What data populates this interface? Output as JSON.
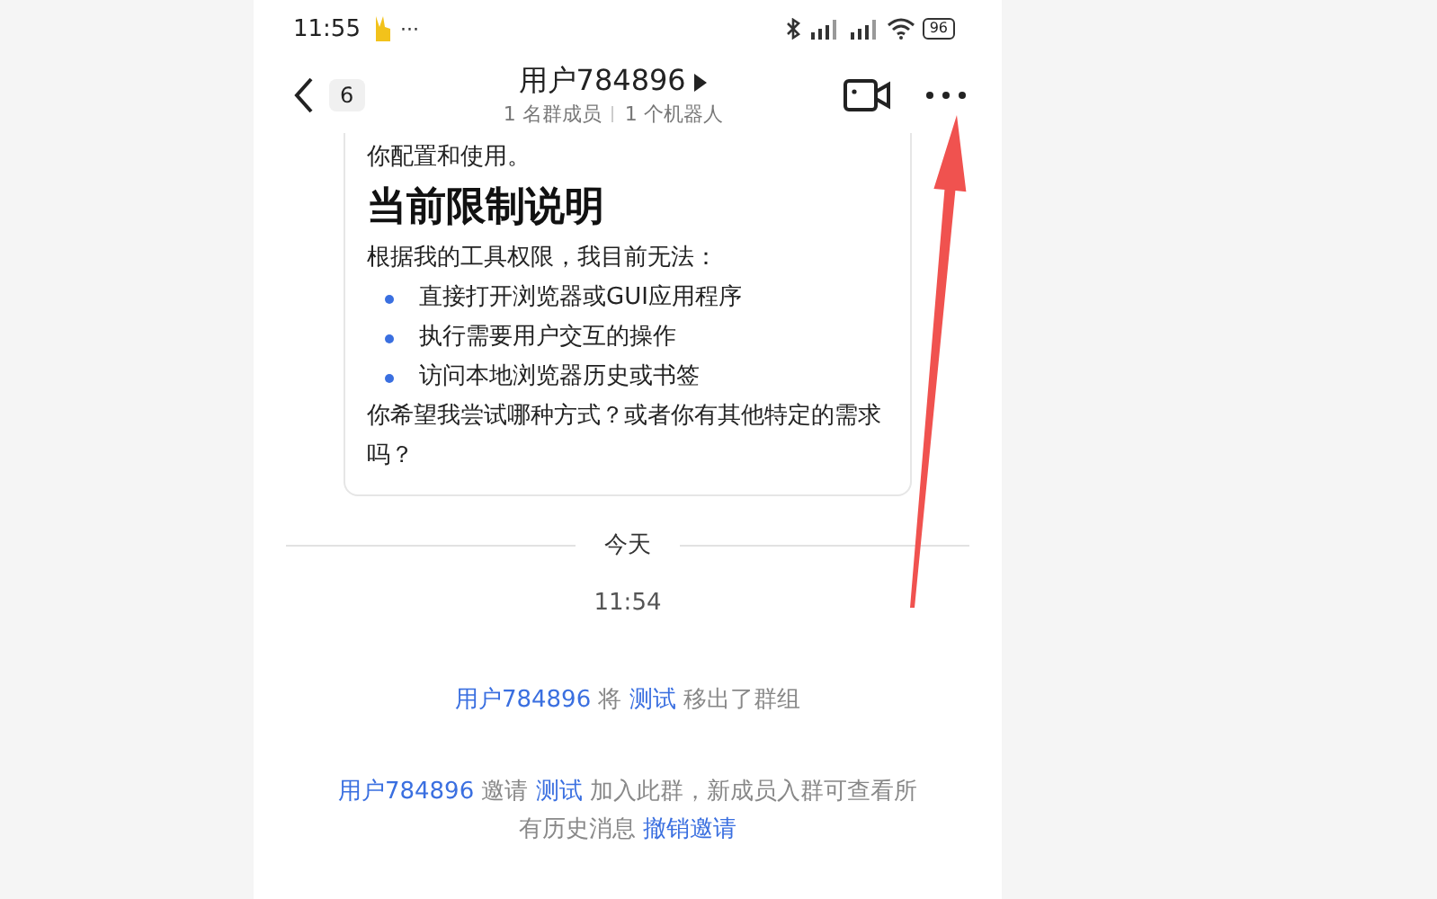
{
  "status_bar": {
    "time": "11:55",
    "dots": "···",
    "battery": "96"
  },
  "header": {
    "back_count": "6",
    "title": "用户784896",
    "subtitle_members": "1 名群成员",
    "subtitle_bots": "1 个机器人"
  },
  "card": {
    "intro": "你配置和使用。",
    "heading": "当前限制说明",
    "lead": "根据我的工具权限，我目前无法：",
    "bullets": [
      "直接打开浏览器或GUI应用程序",
      "执行需要用户交互的操作",
      "访问本地浏览器历史或书签"
    ],
    "closing": "你希望我尝试哪种方式？或者你有其他特定的需求吗？"
  },
  "divider": {
    "label": "今天"
  },
  "time_stamp": "11:54",
  "system_messages": [
    [
      {
        "kind": "link",
        "text": "用户784896"
      },
      {
        "kind": "text",
        "text": " 将 "
      },
      {
        "kind": "link",
        "text": "测试"
      },
      {
        "kind": "text",
        "text": " 移出了群组"
      }
    ],
    [
      {
        "kind": "link",
        "text": "用户784896"
      },
      {
        "kind": "text",
        "text": " 邀请 "
      },
      {
        "kind": "link",
        "text": "测试"
      },
      {
        "kind": "text",
        "text": " 加入此群，新成员入群可查看所有历史消息 "
      },
      {
        "kind": "link",
        "text": "撤销邀请"
      }
    ]
  ]
}
